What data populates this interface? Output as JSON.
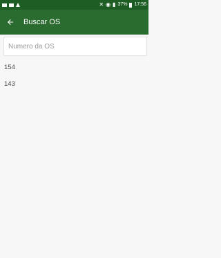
{
  "status_bar": {
    "battery": "37%",
    "time": "17:56"
  },
  "app_bar": {
    "title": "Buscar OS",
    "back_icon": "arrow-back-icon"
  },
  "search": {
    "placeholder": "Numero da OS",
    "value": ""
  },
  "results": [
    {
      "label": "154"
    },
    {
      "label": "143"
    }
  ],
  "colors": {
    "status_bar": "#1e5e25",
    "app_bar": "#2a6b2f",
    "background": "#f7f7f7"
  }
}
